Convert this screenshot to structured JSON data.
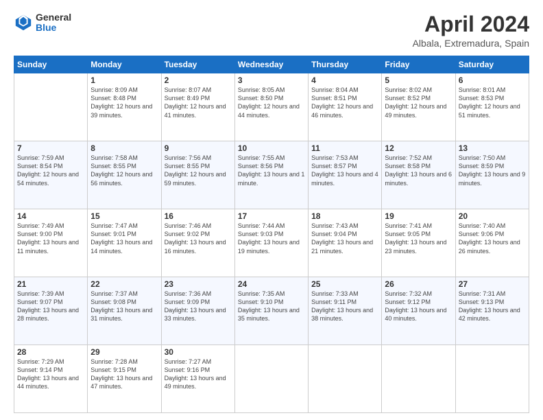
{
  "header": {
    "logo_line1": "General",
    "logo_line2": "Blue",
    "title": "April 2024",
    "subtitle": "Albala, Extremadura, Spain"
  },
  "weekdays": [
    "Sunday",
    "Monday",
    "Tuesday",
    "Wednesday",
    "Thursday",
    "Friday",
    "Saturday"
  ],
  "weeks": [
    [
      {
        "num": "",
        "sunrise": "",
        "sunset": "",
        "daylight": ""
      },
      {
        "num": "1",
        "sunrise": "Sunrise: 8:09 AM",
        "sunset": "Sunset: 8:48 PM",
        "daylight": "Daylight: 12 hours and 39 minutes."
      },
      {
        "num": "2",
        "sunrise": "Sunrise: 8:07 AM",
        "sunset": "Sunset: 8:49 PM",
        "daylight": "Daylight: 12 hours and 41 minutes."
      },
      {
        "num": "3",
        "sunrise": "Sunrise: 8:05 AM",
        "sunset": "Sunset: 8:50 PM",
        "daylight": "Daylight: 12 hours and 44 minutes."
      },
      {
        "num": "4",
        "sunrise": "Sunrise: 8:04 AM",
        "sunset": "Sunset: 8:51 PM",
        "daylight": "Daylight: 12 hours and 46 minutes."
      },
      {
        "num": "5",
        "sunrise": "Sunrise: 8:02 AM",
        "sunset": "Sunset: 8:52 PM",
        "daylight": "Daylight: 12 hours and 49 minutes."
      },
      {
        "num": "6",
        "sunrise": "Sunrise: 8:01 AM",
        "sunset": "Sunset: 8:53 PM",
        "daylight": "Daylight: 12 hours and 51 minutes."
      }
    ],
    [
      {
        "num": "7",
        "sunrise": "Sunrise: 7:59 AM",
        "sunset": "Sunset: 8:54 PM",
        "daylight": "Daylight: 12 hours and 54 minutes."
      },
      {
        "num": "8",
        "sunrise": "Sunrise: 7:58 AM",
        "sunset": "Sunset: 8:55 PM",
        "daylight": "Daylight: 12 hours and 56 minutes."
      },
      {
        "num": "9",
        "sunrise": "Sunrise: 7:56 AM",
        "sunset": "Sunset: 8:55 PM",
        "daylight": "Daylight: 12 hours and 59 minutes."
      },
      {
        "num": "10",
        "sunrise": "Sunrise: 7:55 AM",
        "sunset": "Sunset: 8:56 PM",
        "daylight": "Daylight: 13 hours and 1 minute."
      },
      {
        "num": "11",
        "sunrise": "Sunrise: 7:53 AM",
        "sunset": "Sunset: 8:57 PM",
        "daylight": "Daylight: 13 hours and 4 minutes."
      },
      {
        "num": "12",
        "sunrise": "Sunrise: 7:52 AM",
        "sunset": "Sunset: 8:58 PM",
        "daylight": "Daylight: 13 hours and 6 minutes."
      },
      {
        "num": "13",
        "sunrise": "Sunrise: 7:50 AM",
        "sunset": "Sunset: 8:59 PM",
        "daylight": "Daylight: 13 hours and 9 minutes."
      }
    ],
    [
      {
        "num": "14",
        "sunrise": "Sunrise: 7:49 AM",
        "sunset": "Sunset: 9:00 PM",
        "daylight": "Daylight: 13 hours and 11 minutes."
      },
      {
        "num": "15",
        "sunrise": "Sunrise: 7:47 AM",
        "sunset": "Sunset: 9:01 PM",
        "daylight": "Daylight: 13 hours and 14 minutes."
      },
      {
        "num": "16",
        "sunrise": "Sunrise: 7:46 AM",
        "sunset": "Sunset: 9:02 PM",
        "daylight": "Daylight: 13 hours and 16 minutes."
      },
      {
        "num": "17",
        "sunrise": "Sunrise: 7:44 AM",
        "sunset": "Sunset: 9:03 PM",
        "daylight": "Daylight: 13 hours and 19 minutes."
      },
      {
        "num": "18",
        "sunrise": "Sunrise: 7:43 AM",
        "sunset": "Sunset: 9:04 PM",
        "daylight": "Daylight: 13 hours and 21 minutes."
      },
      {
        "num": "19",
        "sunrise": "Sunrise: 7:41 AM",
        "sunset": "Sunset: 9:05 PM",
        "daylight": "Daylight: 13 hours and 23 minutes."
      },
      {
        "num": "20",
        "sunrise": "Sunrise: 7:40 AM",
        "sunset": "Sunset: 9:06 PM",
        "daylight": "Daylight: 13 hours and 26 minutes."
      }
    ],
    [
      {
        "num": "21",
        "sunrise": "Sunrise: 7:39 AM",
        "sunset": "Sunset: 9:07 PM",
        "daylight": "Daylight: 13 hours and 28 minutes."
      },
      {
        "num": "22",
        "sunrise": "Sunrise: 7:37 AM",
        "sunset": "Sunset: 9:08 PM",
        "daylight": "Daylight: 13 hours and 31 minutes."
      },
      {
        "num": "23",
        "sunrise": "Sunrise: 7:36 AM",
        "sunset": "Sunset: 9:09 PM",
        "daylight": "Daylight: 13 hours and 33 minutes."
      },
      {
        "num": "24",
        "sunrise": "Sunrise: 7:35 AM",
        "sunset": "Sunset: 9:10 PM",
        "daylight": "Daylight: 13 hours and 35 minutes."
      },
      {
        "num": "25",
        "sunrise": "Sunrise: 7:33 AM",
        "sunset": "Sunset: 9:11 PM",
        "daylight": "Daylight: 13 hours and 38 minutes."
      },
      {
        "num": "26",
        "sunrise": "Sunrise: 7:32 AM",
        "sunset": "Sunset: 9:12 PM",
        "daylight": "Daylight: 13 hours and 40 minutes."
      },
      {
        "num": "27",
        "sunrise": "Sunrise: 7:31 AM",
        "sunset": "Sunset: 9:13 PM",
        "daylight": "Daylight: 13 hours and 42 minutes."
      }
    ],
    [
      {
        "num": "28",
        "sunrise": "Sunrise: 7:29 AM",
        "sunset": "Sunset: 9:14 PM",
        "daylight": "Daylight: 13 hours and 44 minutes."
      },
      {
        "num": "29",
        "sunrise": "Sunrise: 7:28 AM",
        "sunset": "Sunset: 9:15 PM",
        "daylight": "Daylight: 13 hours and 47 minutes."
      },
      {
        "num": "30",
        "sunrise": "Sunrise: 7:27 AM",
        "sunset": "Sunset: 9:16 PM",
        "daylight": "Daylight: 13 hours and 49 minutes."
      },
      {
        "num": "",
        "sunrise": "",
        "sunset": "",
        "daylight": ""
      },
      {
        "num": "",
        "sunrise": "",
        "sunset": "",
        "daylight": ""
      },
      {
        "num": "",
        "sunrise": "",
        "sunset": "",
        "daylight": ""
      },
      {
        "num": "",
        "sunrise": "",
        "sunset": "",
        "daylight": ""
      }
    ]
  ]
}
